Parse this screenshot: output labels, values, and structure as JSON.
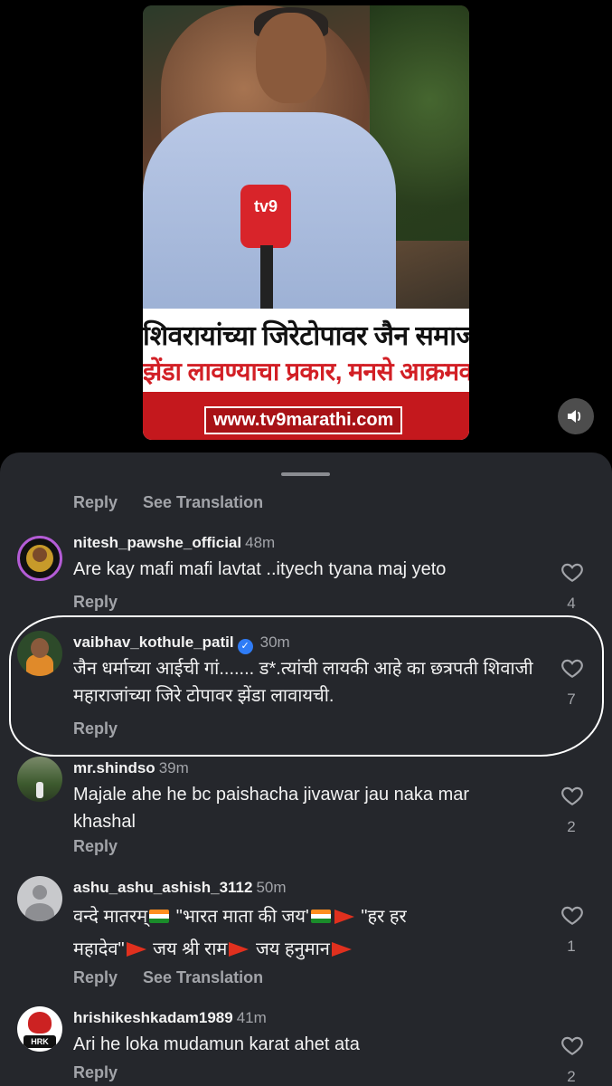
{
  "video": {
    "banner_line1": "शिवरायांच्या जिरेटोपावर जैन समाजाचा",
    "banner_line2": "झेंडा लावण्याचा प्रकार, मनसे आक्रमक",
    "banner_url": "www.tv9marathi.com",
    "mic_logo": "tv9",
    "mute_icon": "speaker-icon"
  },
  "top_actions": {
    "reply": "Reply",
    "see_translation": "See Translation"
  },
  "comments": [
    {
      "username": "nitesh_pawshe_official",
      "time": "48m",
      "text": "Are kay mafi mafi lavtat ..ityech tyana maj yeto",
      "likes": "4",
      "reply": "Reply"
    },
    {
      "username": "vaibhav_kothule_patil",
      "time": "30m",
      "verified": true,
      "text": "जैन धर्माच्या आईची गां....... ड*.त्यांची लायकी आहे का छत्रपती शिवाजी महाराजांच्या जिरे टोपावर झेंडा लावायची.",
      "likes": "7",
      "reply": "Reply"
    },
    {
      "username": "mr.shindso",
      "time": "39m",
      "text": "Majale ahe he bc paishacha jivawar jau naka mar khashal",
      "likes": "2",
      "reply": "Reply"
    },
    {
      "username": "ashu_ashu_ashish_3112",
      "time": "50m",
      "text_part1": "वन्दे मातरम्",
      "text_part2": " \"भारत माता की जय'",
      "text_part3": " \"हर हर",
      "text_part4": "महादेव\"",
      "text_part5": " जय श्री राम",
      "text_part6": "  जय हनुमान",
      "likes": "1",
      "reply": "Reply",
      "see_translation": "See Translation"
    },
    {
      "username": "hrishikeshkadam1989",
      "time": "41m",
      "text": "Ari he loka mudamun karat ahet ata",
      "likes": "2",
      "reply": "Reply",
      "avatar_text": "HRK"
    }
  ]
}
